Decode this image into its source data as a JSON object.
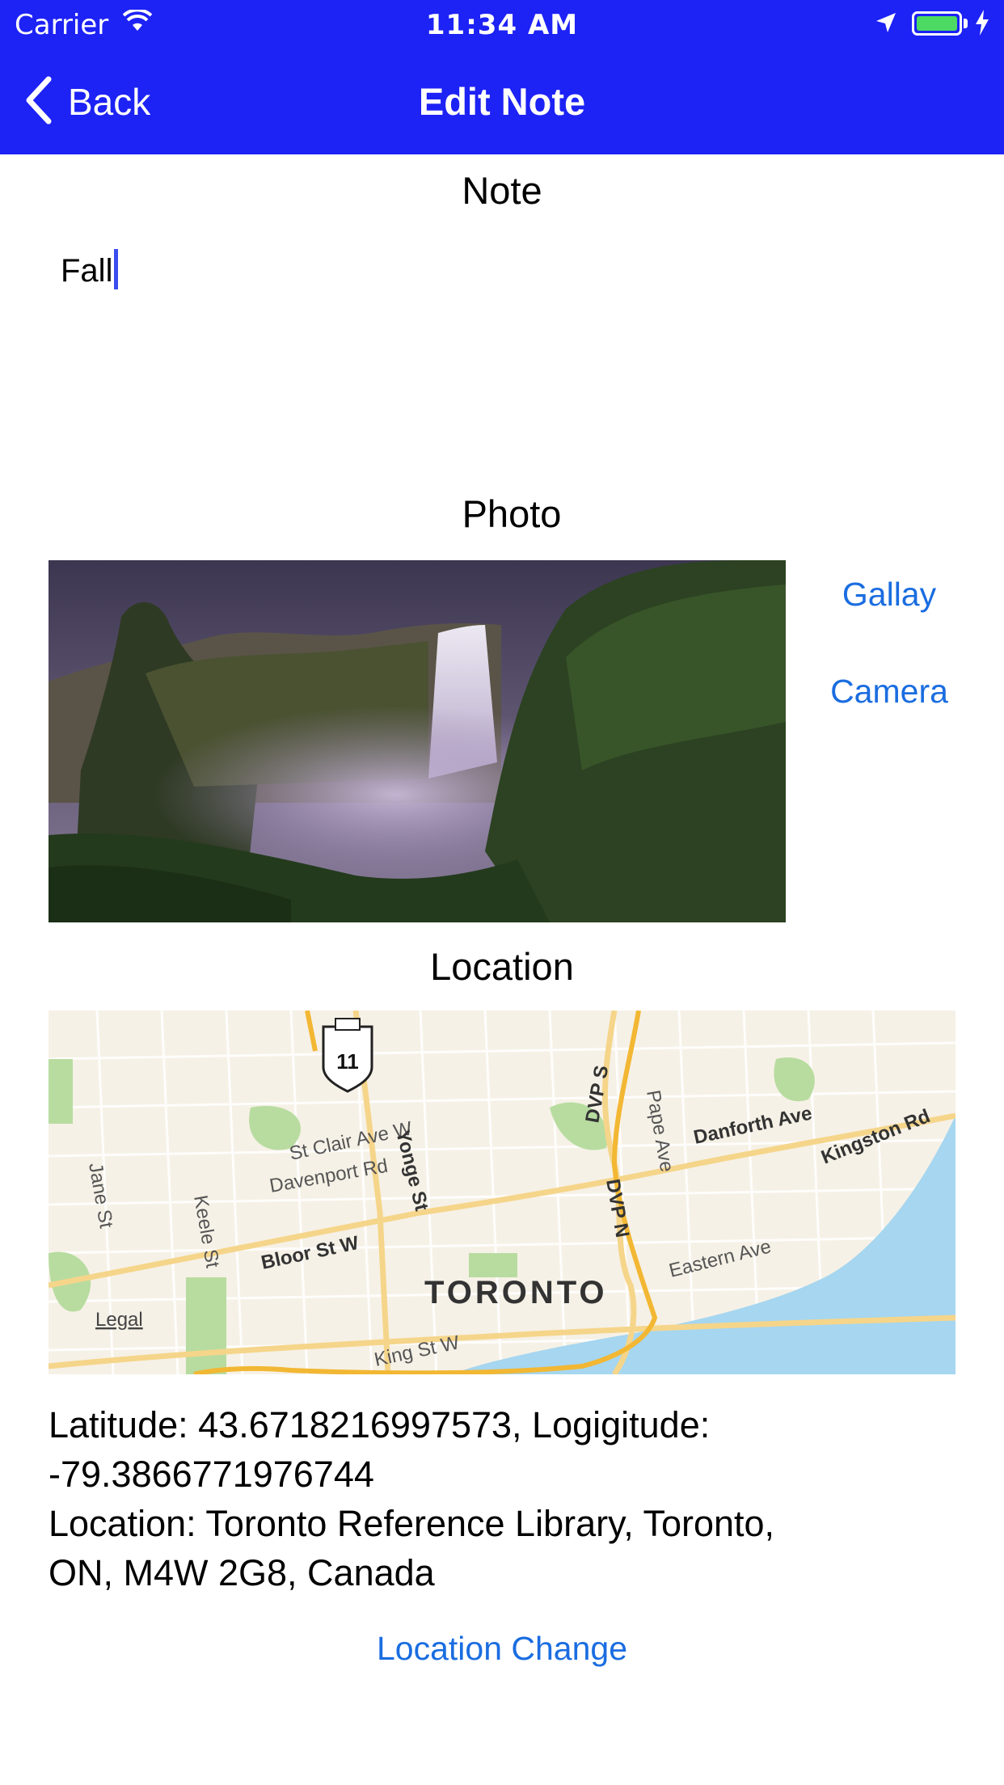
{
  "status_bar": {
    "carrier": "Carrier",
    "time": "11:34 AM",
    "icons": [
      "wifi-icon",
      "location-arrow-icon",
      "battery-icon",
      "charging-bolt-icon"
    ]
  },
  "nav": {
    "back_label": "Back",
    "title": "Edit Note",
    "color": "#1d22f5"
  },
  "note": {
    "section_label": "Note",
    "value": "Fall"
  },
  "photo": {
    "section_label": "Photo",
    "gallery_label": "Gallay",
    "camera_label": "Camera"
  },
  "location": {
    "section_label": "Location",
    "map": {
      "city_label": "TORONTO",
      "legal_label": "Legal",
      "highway_shield": "11",
      "street_labels": [
        "St Clair Ave W",
        "Davenport Rd",
        "Yonge St",
        "DVP S",
        "DVP N",
        "Pape Ave",
        "Danforth Ave",
        "Kingston Rd",
        "Jane St",
        "Keele St",
        "Bloor St W",
        "Eastern Ave",
        "King St W"
      ]
    },
    "latitude_line": "Latitude: 43.6718216997573, Logigitude:",
    "longitude_line": "-79.3866771976744",
    "address_line1": "Location:  Toronto Reference Library, Toronto,",
    "address_line2": "ON, M4W 2G8, Canada",
    "change_label": "Location Change"
  },
  "colors": {
    "link": "#1a6de0",
    "accent": "#1d22f5"
  }
}
